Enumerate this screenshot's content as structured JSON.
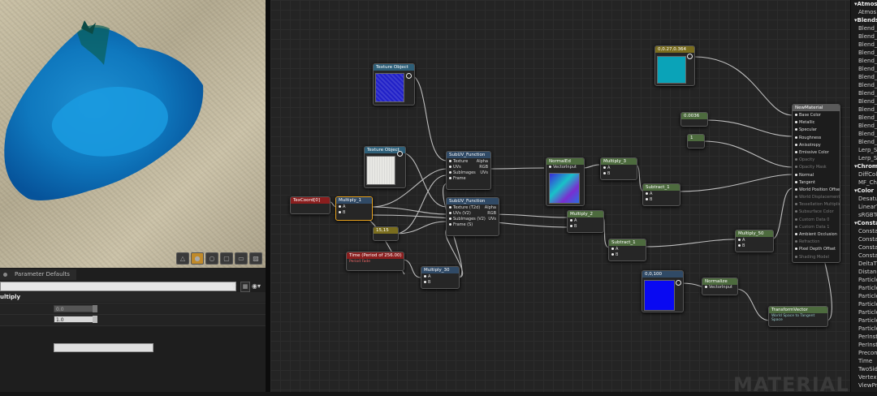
{
  "viewport": {
    "toolbar": [
      "△",
      "●",
      "○",
      "▢",
      "▭",
      "▨"
    ]
  },
  "details": {
    "tab_label": "Parameter Defaults",
    "search_value": "",
    "section_label": "ultiply",
    "fields": [
      {
        "value": "0.0"
      },
      {
        "value": "1.0"
      }
    ]
  },
  "graph": {
    "watermark": "MATERIAL",
    "nodes": {
      "texture_object_1": {
        "title": "Texture Object",
        "thumb_color": "#2121c8"
      },
      "texture_object_2": {
        "title": "Texture Object",
        "thumb_color": "#e8e8e4"
      },
      "texcoord": {
        "title": "TexCoord[0]"
      },
      "multiply_1": {
        "title": "Multiply_1",
        "pins": [
          "A",
          "B"
        ]
      },
      "const_2": {
        "title": "15,15"
      },
      "time": {
        "title": "Time (Period of 256.00)",
        "subtitle": "Period Fade"
      },
      "multiply_30": {
        "title": "Multiply_30",
        "pins": [
          "A",
          "B"
        ]
      },
      "subuv_1": {
        "title": "SubUV_Function",
        "inputs": [
          "Texture",
          "UVs",
          "SubImages",
          "Frame"
        ],
        "outputs": [
          "Alpha",
          "RGB",
          "UVs"
        ]
      },
      "subuv_2": {
        "title": "SubUV_Function",
        "inputs": [
          "Texture (T2d)",
          "UVs (V2)",
          "SubImages (V2)",
          "Frame (S)"
        ],
        "outputs": [
          "Alpha",
          "RGB",
          "UVs"
        ]
      },
      "normalize_a": {
        "title": "NormalEd",
        "pins": [
          "VectorInput"
        ]
      },
      "multiply_2": {
        "title": "Multiply_2",
        "pins": [
          "A",
          "B"
        ]
      },
      "subtract_1": {
        "title": "Subtract_1",
        "pins": [
          "A",
          "B"
        ]
      },
      "multiply_3": {
        "title": "Multiply_3",
        "pins": [
          "A",
          "B"
        ]
      },
      "subtract_2": {
        "title": "Subtract_1",
        "pins": [
          "A",
          "B"
        ]
      },
      "multiply_50": {
        "title": "Multiply_50",
        "pins": [
          "A",
          "B"
        ]
      },
      "const_color": {
        "title": "0,0.27,0.364",
        "color": "#0aa3b8"
      },
      "const_0": {
        "title": "0.0036"
      },
      "const_1": {
        "title": "1"
      },
      "blue_param": {
        "title": "0,0,100",
        "color": "#0909f2"
      },
      "normalize": {
        "title": "Normalize",
        "pins": [
          "VectorInput"
        ]
      },
      "transform_vector": {
        "title": "TransformVector",
        "subtitle": "World Space to Tangent Space"
      },
      "result": {
        "title": "NewMaterial",
        "pins": [
          {
            "label": "Base Color",
            "active": true
          },
          {
            "label": "Metallic",
            "active": true
          },
          {
            "label": "Specular",
            "active": true
          },
          {
            "label": "Roughness",
            "active": true
          },
          {
            "label": "Anisotropy",
            "active": true
          },
          {
            "label": "Emissive Color",
            "active": true
          },
          {
            "label": "Opacity",
            "active": false
          },
          {
            "label": "Opacity Mask",
            "active": false
          },
          {
            "label": "Normal",
            "active": true
          },
          {
            "label": "Tangent",
            "active": true
          },
          {
            "label": "World Position Offset",
            "active": true
          },
          {
            "label": "World Displacement",
            "active": false
          },
          {
            "label": "Tessellation Multiplier",
            "active": false
          },
          {
            "label": "Subsurface Color",
            "active": false
          },
          {
            "label": "Custom Data 0",
            "active": false
          },
          {
            "label": "Custom Data 1",
            "active": false
          },
          {
            "label": "Ambient Occlusion",
            "active": true
          },
          {
            "label": "Refraction",
            "active": false
          },
          {
            "label": "Pixel Depth Offset",
            "active": true
          },
          {
            "label": "Shading Model",
            "active": false
          }
        ]
      }
    }
  },
  "palette": {
    "items": [
      {
        "text": "Atmosph",
        "cat": true
      },
      {
        "text": "Atmos",
        "cat": false
      },
      {
        "text": "Blends",
        "cat": true
      },
      {
        "text": "Blend_C",
        "cat": false
      },
      {
        "text": "Blend_C",
        "cat": false
      },
      {
        "text": "Blend_C",
        "cat": false
      },
      {
        "text": "Blend_D",
        "cat": false
      },
      {
        "text": "Blend_E",
        "cat": false
      },
      {
        "text": "Blend_H",
        "cat": false
      },
      {
        "text": "Blend_L",
        "cat": false
      },
      {
        "text": "Blend_L",
        "cat": false
      },
      {
        "text": "Blend_L",
        "cat": false
      },
      {
        "text": "Blend_L",
        "cat": false
      },
      {
        "text": "Blend_C",
        "cat": false
      },
      {
        "text": "Blend_C",
        "cat": false
      },
      {
        "text": "Blend_P",
        "cat": false
      },
      {
        "text": "Blend_S",
        "cat": false
      },
      {
        "text": "Blend_S",
        "cat": false
      },
      {
        "text": "Lerp_Sc",
        "cat": false
      },
      {
        "text": "Lerp_Sc",
        "cat": false
      },
      {
        "text": "Chromak",
        "cat": true
      },
      {
        "text": "DiffCol",
        "cat": false
      },
      {
        "text": "MF_Che",
        "cat": false
      },
      {
        "text": "Color",
        "cat": true
      },
      {
        "text": "Desatu",
        "cat": false
      },
      {
        "text": "LinearT",
        "cat": false
      },
      {
        "text": "sRGBTo",
        "cat": false
      },
      {
        "text": "Constant",
        "cat": true
      },
      {
        "text": "Consta",
        "cat": false
      },
      {
        "text": "Consta",
        "cat": false
      },
      {
        "text": "Consta",
        "cat": false
      },
      {
        "text": "Consta",
        "cat": false
      },
      {
        "text": "DeltaTi",
        "cat": false
      },
      {
        "text": "Distanc",
        "cat": false
      },
      {
        "text": "Particle",
        "cat": false
      },
      {
        "text": "Particle",
        "cat": false
      },
      {
        "text": "Particle",
        "cat": false
      },
      {
        "text": "Particle",
        "cat": false
      },
      {
        "text": "Particle",
        "cat": false
      },
      {
        "text": "Particle",
        "cat": false
      },
      {
        "text": "Particle",
        "cat": false
      },
      {
        "text": "PerInst",
        "cat": false
      },
      {
        "text": "PerInst",
        "cat": false
      },
      {
        "text": "Precom",
        "cat": false
      },
      {
        "text": "Time",
        "cat": false
      },
      {
        "text": "TwoSid",
        "cat": false
      },
      {
        "text": "VertexC",
        "cat": false
      },
      {
        "text": "ViewPr",
        "cat": false
      }
    ]
  }
}
